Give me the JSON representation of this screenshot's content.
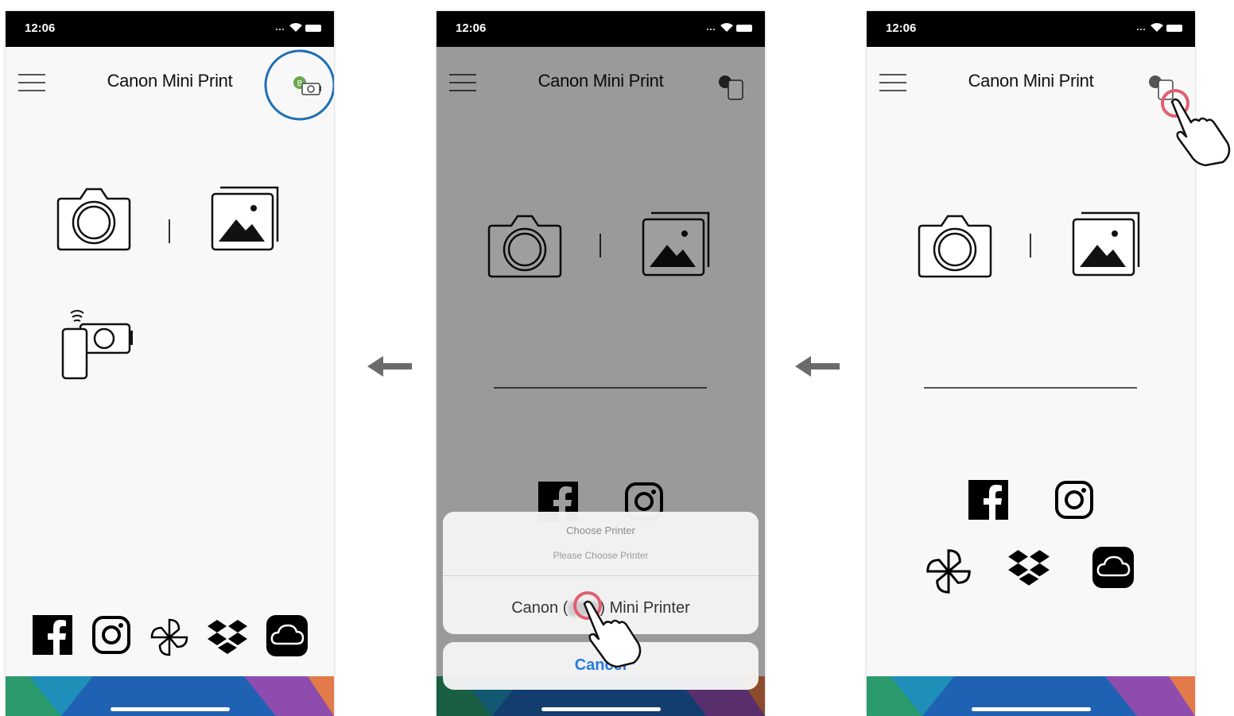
{
  "status_bar": {
    "time": "12:06"
  },
  "screens": [
    {
      "app_title": "Canon Mini Print"
    },
    {
      "app_title": "Canon Mini Print",
      "dialog": {
        "title": "Choose Printer",
        "message": "Please Choose Printer",
        "printer_prefix": "Canon (",
        "printer_suffix": ") Mini Printer",
        "cancel_label": "Cancel"
      }
    },
    {
      "app_title": "Canon Mini Print"
    }
  ],
  "colors": {
    "highlight_circle": "#1f6fb5",
    "tap_ring": "#e06070",
    "cancel": "#2a7ae2",
    "connected_dot": "#6aa84f"
  },
  "icons": [
    "menu-icon",
    "printer-status-icon",
    "camera-icon",
    "photo-gallery-icon",
    "remote-camera-icon",
    "facebook-icon",
    "instagram-icon",
    "google-photos-icon",
    "dropbox-icon",
    "cloud-icon",
    "back-arrow-icon",
    "hand-pointer-icon"
  ]
}
